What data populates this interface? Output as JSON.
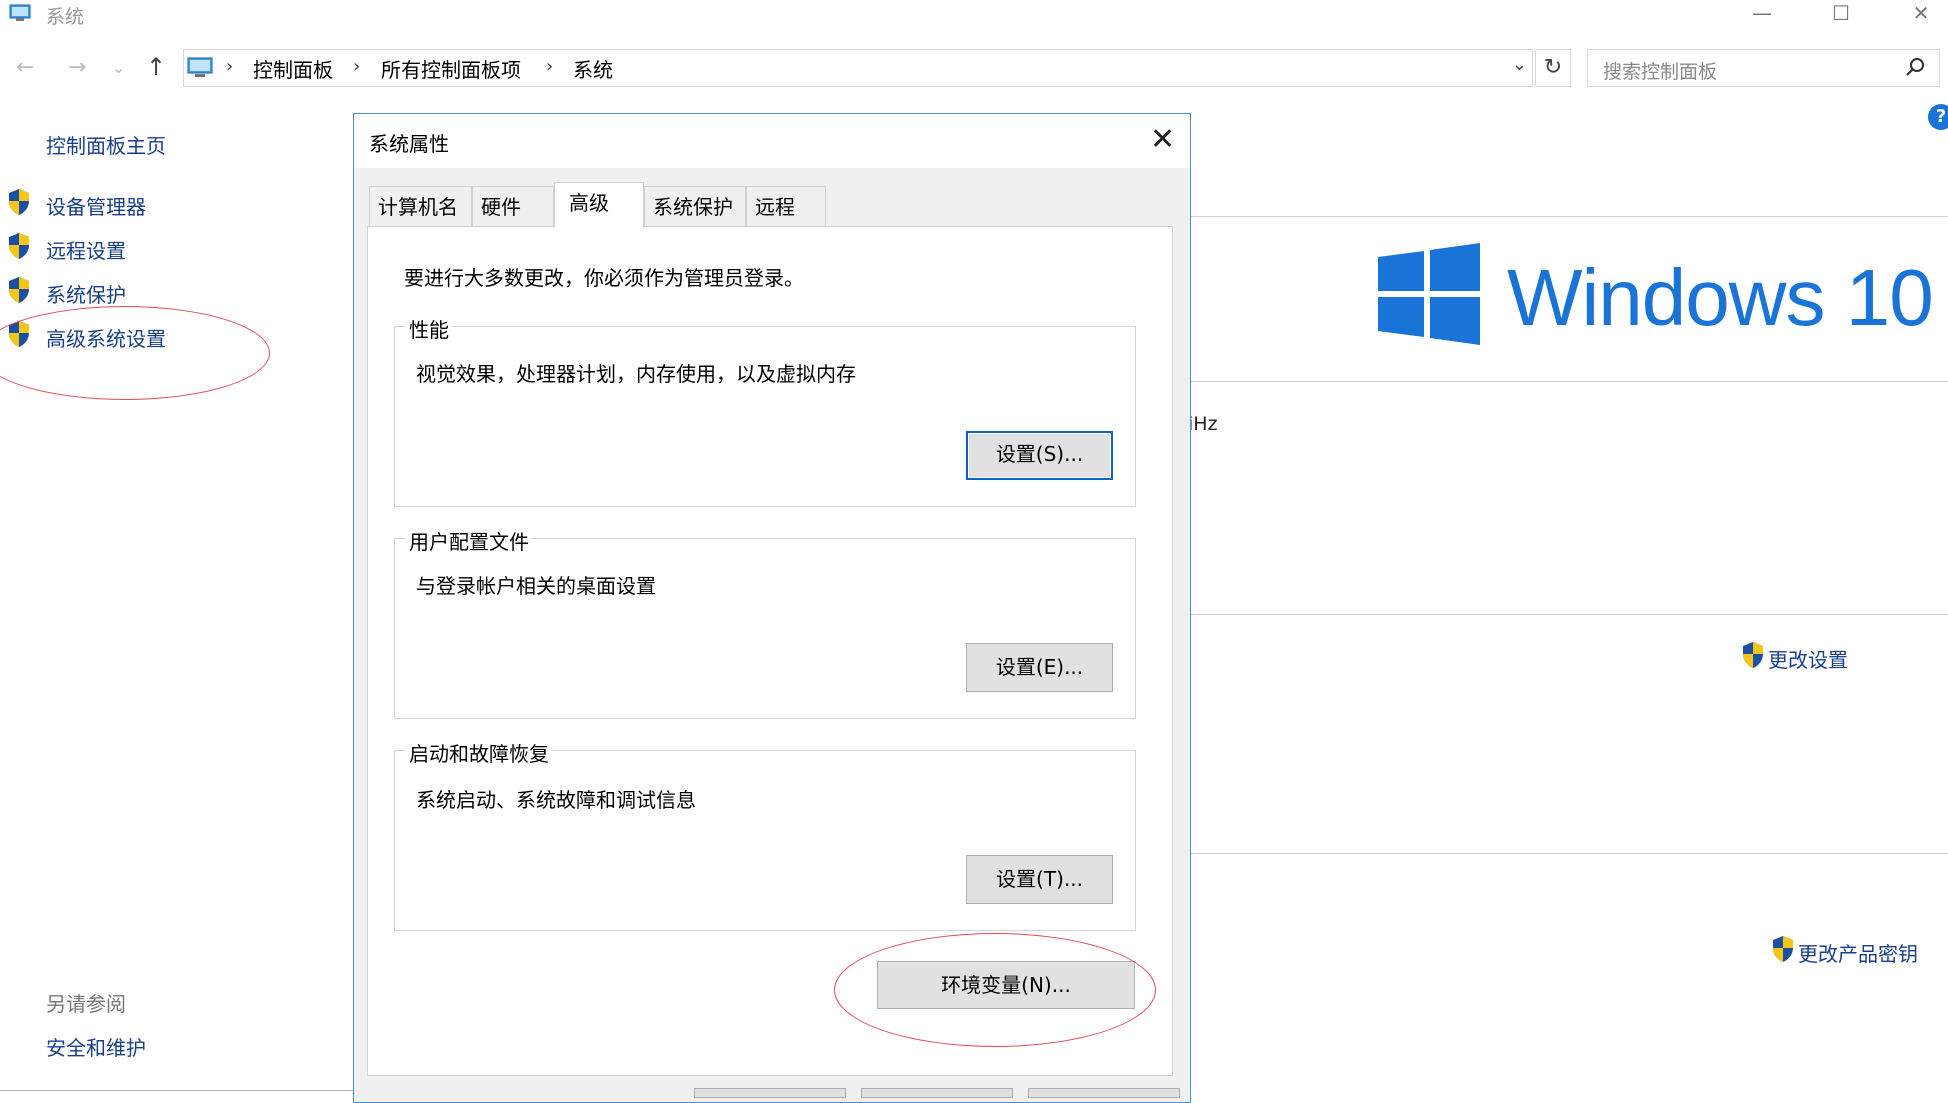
{
  "window": {
    "title": "系统"
  },
  "title_controls": {
    "minimize": "—",
    "maximize": "☐",
    "close": "✕"
  },
  "address_bar": {
    "back": "←",
    "forward": "→",
    "history": "⌄",
    "up": "↑",
    "breadcrumbs": [
      "控制面板",
      "所有控制面板项",
      "系统"
    ],
    "separator": "›",
    "dropdown": "⌄",
    "refresh": "↻"
  },
  "search": {
    "placeholder": "搜索控制面板"
  },
  "sidebar": {
    "home": "控制面板主页",
    "items": [
      {
        "label": "设备管理器",
        "icon": "shield-icon"
      },
      {
        "label": "远程设置",
        "icon": "shield-icon"
      },
      {
        "label": "系统保护",
        "icon": "shield-icon"
      },
      {
        "label": "高级系统设置",
        "icon": "shield-icon"
      }
    ],
    "see_also": "另请参阅",
    "see_also_items": [
      "安全和维护"
    ]
  },
  "help": "?",
  "content": {
    "logo_text": "Windows 10",
    "partial_text": "iHz",
    "change_settings": "更改设置",
    "change_product_key": "更改产品密钥",
    "accent_color": "#1a73d6"
  },
  "dialog": {
    "title": "系统属性",
    "close": "✕",
    "tabs": [
      "计算机名",
      "硬件",
      "高级",
      "系统保护",
      "远程"
    ],
    "active_tab": "高级",
    "admin_note": "要进行大多数更改，你必须作为管理员登录。",
    "groups": [
      {
        "title": "性能",
        "description": "视觉效果，处理器计划，内存使用，以及虚拟内存",
        "button": "设置(S)..."
      },
      {
        "title": "用户配置文件",
        "description": "与登录帐户相关的桌面设置",
        "button": "设置(E)..."
      },
      {
        "title": "启动和故障恢复",
        "description": "系统启动、系统故障和调试信息",
        "button": "设置(T)..."
      }
    ],
    "env_button": "环境变量(N)..."
  }
}
